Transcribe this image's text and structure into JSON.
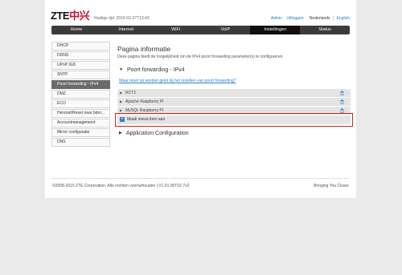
{
  "header": {
    "logo_latin": "ZTE",
    "logo_cn": "中兴",
    "time": "Huidige tijd: 2016-02-27T13:43",
    "admin": "Admin",
    "logout": "Uitloggen",
    "sep": "|",
    "lang_nl": "Nederlands",
    "lang_en": "English"
  },
  "nav": [
    "Home",
    "Internet",
    "WiFi",
    "VoIP",
    "Instellingen",
    "Status"
  ],
  "sidebar": [
    "DHCP",
    "DDNS",
    "UPnP IGD",
    "SNTP",
    "Poort forwarding - IPv4",
    "DMZ",
    "ECO",
    "Herstart/Reset naar fabri...",
    "Accountmanagement",
    "Mirror configuratie",
    "DNS"
  ],
  "main": {
    "title": "Pagina informatie",
    "description": "Deze pagina biedt de mogelijkheid om de IPv4 poort forwarding parameter(s) te configureren.",
    "section1": "Poort forwarding - IPv4",
    "help_link": "Waar moet op worden gelet bij het instellen van poort forwarding?",
    "rules": [
      "RCT2",
      "Apache Raspberry PI",
      "MySQL Raspberry PI"
    ],
    "add_label": "Maak nieuw item aan",
    "plus": "+",
    "section2": "Application Configuration",
    "arrow_down": "▼",
    "arrow_right": "▶"
  },
  "footer": {
    "copyright": "©2008-2015 ZTE Corporation. Alle rechten voorbehouden  |  V1.01.00T02.7v2",
    "tagline": "Bringing You Closer"
  },
  "colors": {
    "accent": "#2a7fc9",
    "highlight": "#d42020",
    "nav": "#3b3b3b"
  }
}
